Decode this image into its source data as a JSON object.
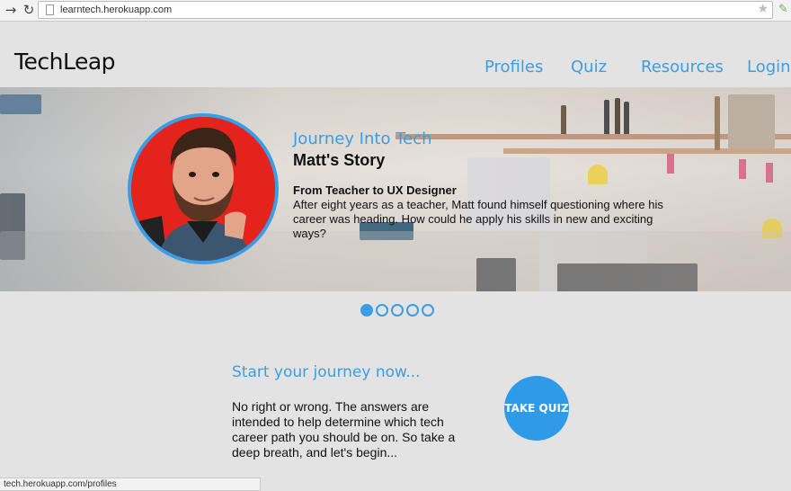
{
  "browser": {
    "url": "learntech.herokuapp.com",
    "status_url": "tech.herokuapp.com/profiles"
  },
  "site": {
    "logo": "TechLeap",
    "nav": [
      "Profiles",
      "Quiz",
      "Resources",
      "Login"
    ]
  },
  "hero": {
    "kicker": "Journey Into Tech",
    "title": "Matt's Story",
    "subtitle": "From Teacher to UX Designer",
    "body": "After eight years as a teacher, Matt found himself questioning where his career was heading. How could he apply his skills in new and exciting ways?",
    "slides_total": 5,
    "active_slide": 1
  },
  "cta": {
    "title": "Start your journey now...",
    "body": "No right or wrong. The answers are intended to help determine which tech career path you should be on. So take a deep breath, and let's begin...",
    "button": "TAKE QUIZ"
  },
  "colors": {
    "accent": "#3a9ee6",
    "avatar_bg": "#e4231d"
  },
  "icons": [
    "back-icon",
    "reload-icon",
    "page-icon",
    "star-icon",
    "extension-icon"
  ]
}
